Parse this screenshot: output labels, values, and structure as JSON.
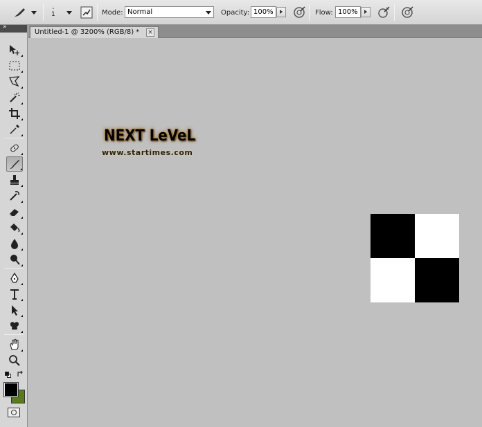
{
  "options_bar": {
    "brush_size": "1",
    "mode_label": "Mode:",
    "mode_value": "Normal",
    "opacity_label": "Opacity:",
    "opacity_value": "100%",
    "flow_label": "Flow:",
    "flow_value": "100%"
  },
  "document": {
    "tab_title": "Untitled-1 @ 3200% (RGB/8) *",
    "close_glyph": "×"
  },
  "watermark": {
    "title": "NEXT LeVeL",
    "url": "www.startimes.com"
  },
  "colors": {
    "foreground": "#000000",
    "background": "#5a7a1e",
    "checker_dark": "#000000",
    "checker_light": "#ffffff"
  },
  "toolbox": {
    "collapse_glyph": "»",
    "tools": [
      "move-tool-icon",
      "marquee-tool-icon",
      "lasso-tool-icon",
      "magic-wand-tool-icon",
      "crop-tool-icon",
      "eyedropper-tool-icon",
      "healing-brush-tool-icon",
      "brush-tool-icon",
      "clone-stamp-tool-icon",
      "history-brush-tool-icon",
      "eraser-tool-icon",
      "paint-bucket-tool-icon",
      "blur-tool-icon",
      "dodge-tool-icon",
      "pen-tool-icon",
      "type-tool-icon",
      "path-selection-tool-icon",
      "custom-shape-tool-icon",
      "hand-tool-icon",
      "zoom-tool-icon"
    ]
  }
}
